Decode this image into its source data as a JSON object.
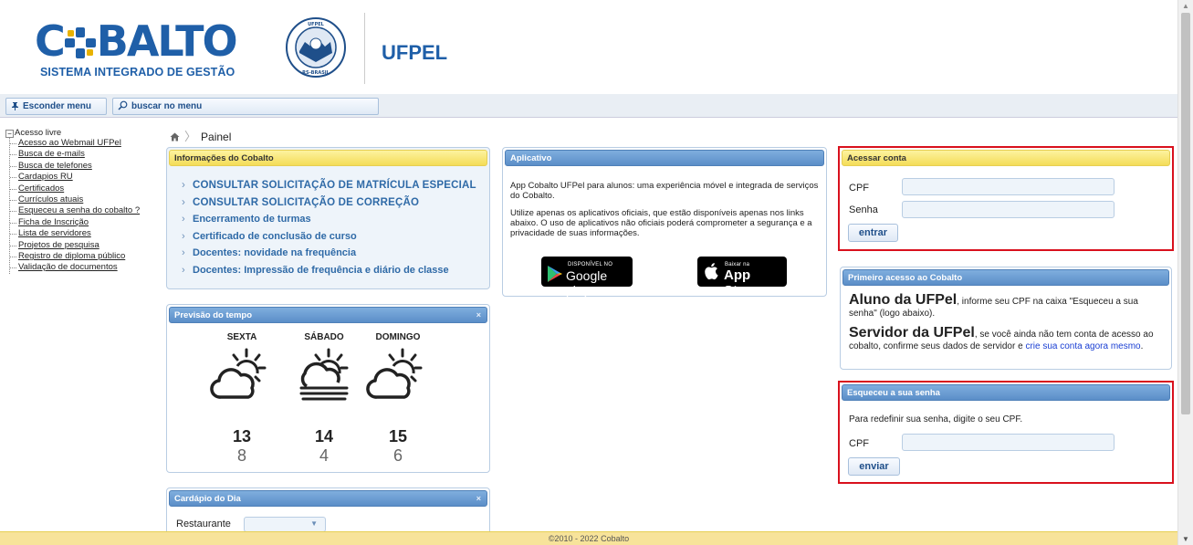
{
  "header": {
    "logo_text": "CO BALTO",
    "logo_subtitle": "SISTEMA INTEGRADO DE GESTÃO",
    "university": "UFPEL",
    "seal_text": "UNIVERSIDADE FEDERAL DE PELOTAS RS-BRASIL"
  },
  "toolbar": {
    "hide_menu_label": "Esconder menu",
    "search_menu_label": "buscar no menu",
    "hide_icon": "pin-icon",
    "search_icon": "search-icon"
  },
  "sidebar": {
    "root_label": "Acesso livre",
    "items": [
      "Acesso ao Webmail UFPel",
      "Busca de e-mails",
      "Busca de telefones",
      "Cardapios RU",
      "Certificados",
      "Currículos atuais",
      "Esqueceu a senha do cobalto ?",
      "Ficha de Inscrição",
      "Lista de servidores",
      "Projetos de pesquisa",
      "Registro de diploma público",
      "Validação de documentos"
    ]
  },
  "breadcrumb": {
    "home_icon": "home-icon",
    "current": "Painel"
  },
  "info_panel": {
    "title": "Informações do Cobalto",
    "items": [
      "CONSULTAR SOLICITAÇÃO DE MATRÍCULA ESPECIAL",
      "CONSULTAR SOLICITAÇÃO DE CORREÇÃO",
      "Encerramento de turmas",
      "Certificado de conclusão de curso",
      "Docentes: novidade na frequência",
      "Docentes: Impressão de frequência e diário de classe"
    ]
  },
  "weather_panel": {
    "title": "Previsão do tempo",
    "close": "×",
    "days": [
      {
        "name": "SEXTA",
        "icon": "partly-cloudy-icon",
        "max": "13",
        "min": "8"
      },
      {
        "name": "SÁBADO",
        "icon": "fog-sun-icon",
        "max": "14",
        "min": "4"
      },
      {
        "name": "DOMINGO",
        "icon": "partly-cloudy-icon",
        "max": "15",
        "min": "6"
      }
    ]
  },
  "cardapio_panel": {
    "title": "Cardápio do Dia",
    "close": "×",
    "restaurant_label": "Restaurante",
    "restaurant_value": ""
  },
  "app_panel": {
    "title": "Aplicativo",
    "text1": "App Cobalto UFPel para alunos: uma experiência móvel e integrada de serviços do Cobalto.",
    "text2": "Utilize apenas os aplicativos oficiais, que estão disponíveis apenas nos links abaixo. O uso de aplicativos não oficiais poderá comprometer a segurança e a privacidade de suas informações.",
    "google_small": "DISPONÍVEL NO",
    "google_big": "Google play",
    "apple_small": "Baixar na",
    "apple_big": "App Store"
  },
  "login_panel": {
    "title": "Acessar conta",
    "cpf_label": "CPF",
    "cpf_value": "",
    "senha_label": "Senha",
    "senha_value": "",
    "submit_label": "entrar"
  },
  "first_access_panel": {
    "title": "Primeiro acesso ao Cobalto",
    "aluno_big": "Aluno da UFPel",
    "aluno_text": ", informe seu CPF na caixa \"Esqueceu a sua senha\" (logo abaixo).",
    "servidor_big": "Servidor da UFPel",
    "servidor_text": ", se você ainda não tem conta de acesso ao cobalto, confirme seus dados de servidor e ",
    "servidor_link": "crie sua conta agora mesmo",
    "servidor_end": "."
  },
  "forgot_panel": {
    "title": "Esqueceu a sua senha",
    "text": "Para redefinir sua senha, digite o seu CPF.",
    "cpf_label": "CPF",
    "cpf_value": "",
    "submit_label": "enviar"
  },
  "footer": {
    "text": "©2010 - 2022 Cobalto"
  },
  "colors": {
    "brand_blue": "#1f5fa8",
    "highlight_red": "#d9111d",
    "panel_yellow": "#f4dc58",
    "panel_blue": "#5b8ec8"
  }
}
